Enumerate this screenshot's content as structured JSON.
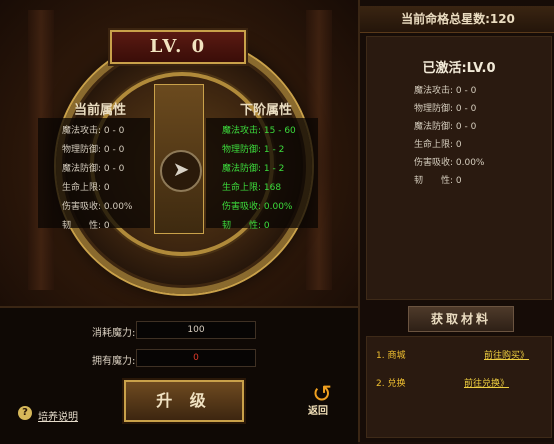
{
  "level_badge": "LV. 0",
  "current_attrs": {
    "title": "当前属性",
    "lines": [
      "魔法攻击: 0 - 0",
      "物理防御: 0 - 0",
      "魔法防御: 0 - 0",
      "生命上限: 0",
      "伤害吸收: 0.00%",
      "韧　　性: 0"
    ]
  },
  "next_attrs": {
    "title": "下阶属性",
    "lines": [
      "魔法攻击: 15 - 60",
      "物理防御: 1 - 2",
      "魔法防御: 1 - 2",
      "生命上限: 168",
      "伤害吸收: 0.00%",
      "韧　　性: 0"
    ]
  },
  "cost": {
    "label": "消耗魔力:",
    "value": "100"
  },
  "owned": {
    "label": "拥有魔力:",
    "value": "0"
  },
  "upgrade_label": "升 级",
  "back_label": "返回",
  "help_label": "培养说明",
  "total_stars": "当前命格总星数:120",
  "activated": {
    "title": "已激活:LV.0",
    "lines": [
      "魔法攻击: 0 - 0",
      "物理防御: 0 - 0",
      "魔法防御: 0 - 0",
      "生命上限: 0",
      "伤害吸收: 0.00%",
      "韧　　性: 0"
    ]
  },
  "materials": {
    "title": "获取材料",
    "items": [
      {
        "label": "1. 商城",
        "link": "前往购买》"
      },
      {
        "label": "2. 兑换",
        "link": "前往兑换》"
      }
    ]
  },
  "colors": {
    "next_attr": "#3cdc3c",
    "owned_value": "#e03a2a",
    "material_text": "#f0c030"
  },
  "icons": {
    "arrow": "chevron-right-icon",
    "back": "return-arrow-icon",
    "help": "question-icon"
  }
}
